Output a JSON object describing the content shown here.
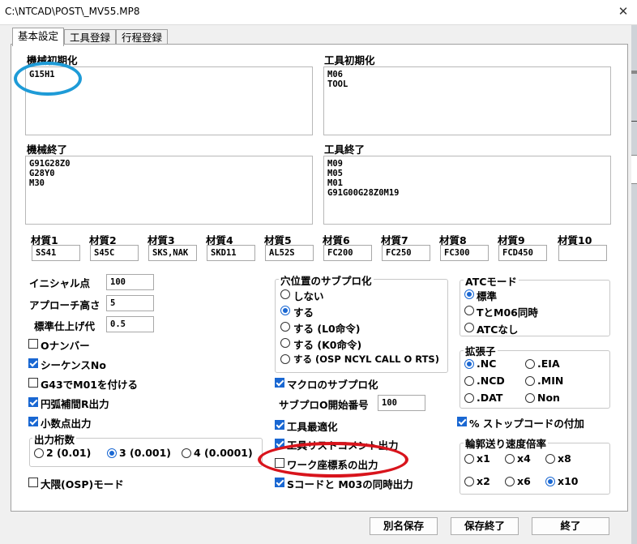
{
  "window": {
    "title": "C:\\NTCAD\\POST\\_MV55.MP8",
    "close": "✕"
  },
  "tabs": [
    "基本設定",
    "工具登録",
    "行程登録"
  ],
  "machine_init": {
    "label": "機械初期化",
    "value": "G15H1"
  },
  "tool_init": {
    "label": "工具初期化",
    "value": "M06\nTOOL"
  },
  "machine_end": {
    "label": "機械終了",
    "value": "G91G28Z0\nG28Y0\nM30"
  },
  "tool_end": {
    "label": "工具終了",
    "value": "M09\nM05\nM01\nG91G00G28Z0M19"
  },
  "materials": [
    {
      "label": "材質1",
      "value": "SS41"
    },
    {
      "label": "材質2",
      "value": "S45C"
    },
    {
      "label": "材質3",
      "value": "SKS,NAK"
    },
    {
      "label": "材質4",
      "value": "SKD11"
    },
    {
      "label": "材質5",
      "value": "AL52S"
    },
    {
      "label": "材質6",
      "value": "FC200"
    },
    {
      "label": "材質7",
      "value": "FC250"
    },
    {
      "label": "材質8",
      "value": "FC300"
    },
    {
      "label": "材質9",
      "value": "FCD450"
    },
    {
      "label": "材質10",
      "value": ""
    }
  ],
  "params": {
    "initial_point": {
      "label": "イニシャル点",
      "value": "100"
    },
    "approach_height": {
      "label": "アプローチ高さ",
      "value": "5"
    },
    "finish_allowance": {
      "label": "標準仕上げ代",
      "value": "0.5"
    }
  },
  "left_checks": {
    "o_number": {
      "label": "Oナンバー",
      "checked": false
    },
    "sequence_no": {
      "label": "シーケンスNo",
      "checked": true
    },
    "g43_m01": {
      "label": "G43でM01を付ける",
      "checked": false
    },
    "arc_r": {
      "label": "円弧補間R出力",
      "checked": true
    },
    "decimal": {
      "label": "小数点出力",
      "checked": true
    },
    "osp_mode": {
      "label": "大隈(OSP)モード",
      "checked": false
    }
  },
  "digits": {
    "label": "出力桁数",
    "options": [
      "2 (0.01)",
      "3 (0.001)",
      "4 (0.0001)"
    ],
    "selected": 1
  },
  "hole_sub": {
    "label": "穴位置のサブプロ化",
    "options": [
      "しない",
      "する",
      "する (L0命令)",
      "する (K0命令)",
      "する (OSP NCYL CALL O RTS)"
    ],
    "selected": 1
  },
  "mid_checks": {
    "macro_sub": {
      "label": "マクロのサブプロ化",
      "checked": true
    },
    "tool_opt": {
      "label": "工具最適化",
      "checked": true
    },
    "tool_list": {
      "label": "工具リストコメント出力",
      "checked": true
    },
    "work_coord": {
      "label": "ワーク座標系の出力",
      "checked": false
    },
    "s_m03": {
      "label": "Sコードと M03の同時出力",
      "checked": true
    }
  },
  "sub_o_start": {
    "label": "サブプロO開始番号",
    "value": "100"
  },
  "atc": {
    "label": "ATCモード",
    "options": [
      "標準",
      "TとM06同時",
      "ATCなし"
    ],
    "selected": 0
  },
  "ext": {
    "label": "拡張子",
    "options": [
      ".NC",
      ".EIA",
      ".NCD",
      ".MIN",
      ".DAT",
      "Non"
    ],
    "selected": 0
  },
  "stop_code": {
    "label": "% ストップコードの付加",
    "checked": true
  },
  "feed": {
    "label": "輪郭送り速度倍率",
    "options": [
      "x1",
      "x4",
      "x8",
      "x2",
      "x6",
      "x10"
    ],
    "selected": 5
  },
  "buttons": {
    "save_as": "別名保存",
    "save_exit": "保存終了",
    "exit": "終了"
  },
  "annotation_colors": {
    "blue_circle": "#1e9bd7",
    "red_circle": "#d8141c"
  }
}
